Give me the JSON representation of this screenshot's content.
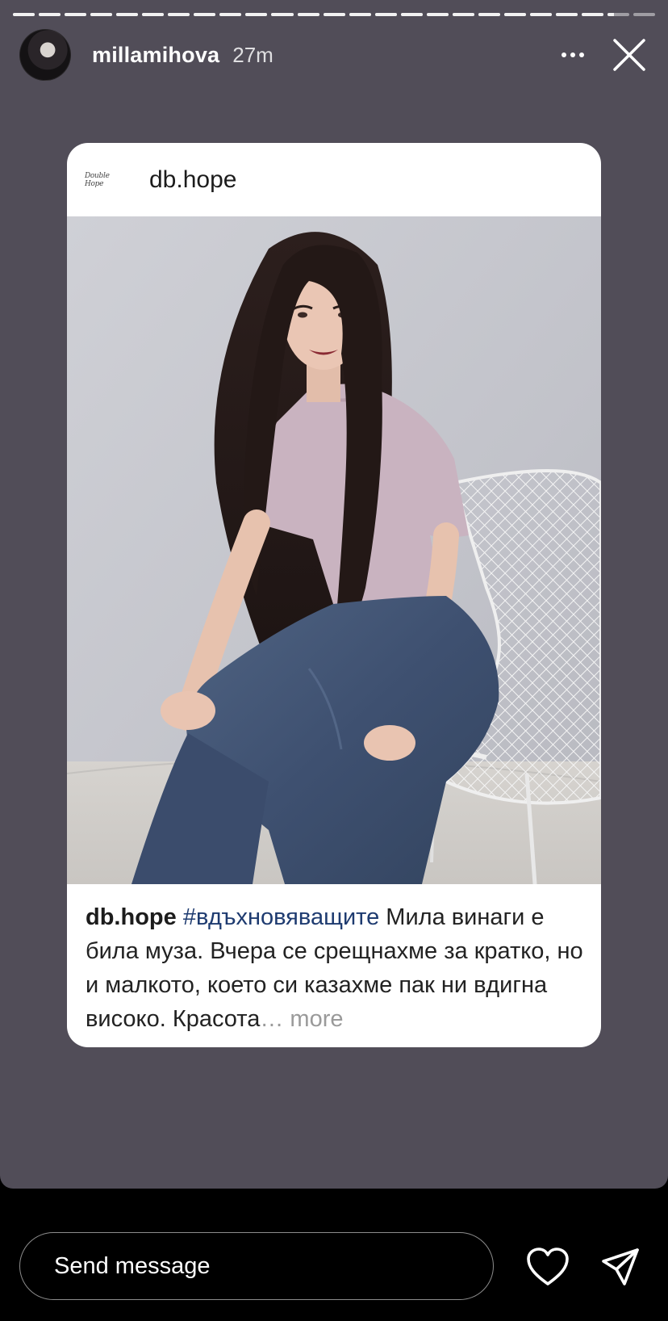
{
  "story": {
    "segments_total": 25,
    "segments_completed": 23,
    "current_segment_progress": 0.3,
    "username": "millamihova",
    "timestamp": "27m",
    "avatar_icon": "profile-avatar"
  },
  "shared_post": {
    "author": "db.hope",
    "logo_text": "Double Hope",
    "caption": {
      "author": "db.hope",
      "hashtag": "#вдъхновяващите",
      "text": " Мила винаги е била муза. Вчера се срещнахме за кратко, но и малкото, което си казахме пак ни вдигна високо. Красота",
      "ellipsis": "…",
      "more": " more"
    }
  },
  "footer": {
    "message_placeholder": "Send message",
    "like_icon": "heart-icon",
    "send_icon": "paper-plane-icon"
  },
  "colors": {
    "story_background": "#514d58",
    "hashtag": "#1e3b70",
    "more_text": "#9a9a9a"
  }
}
